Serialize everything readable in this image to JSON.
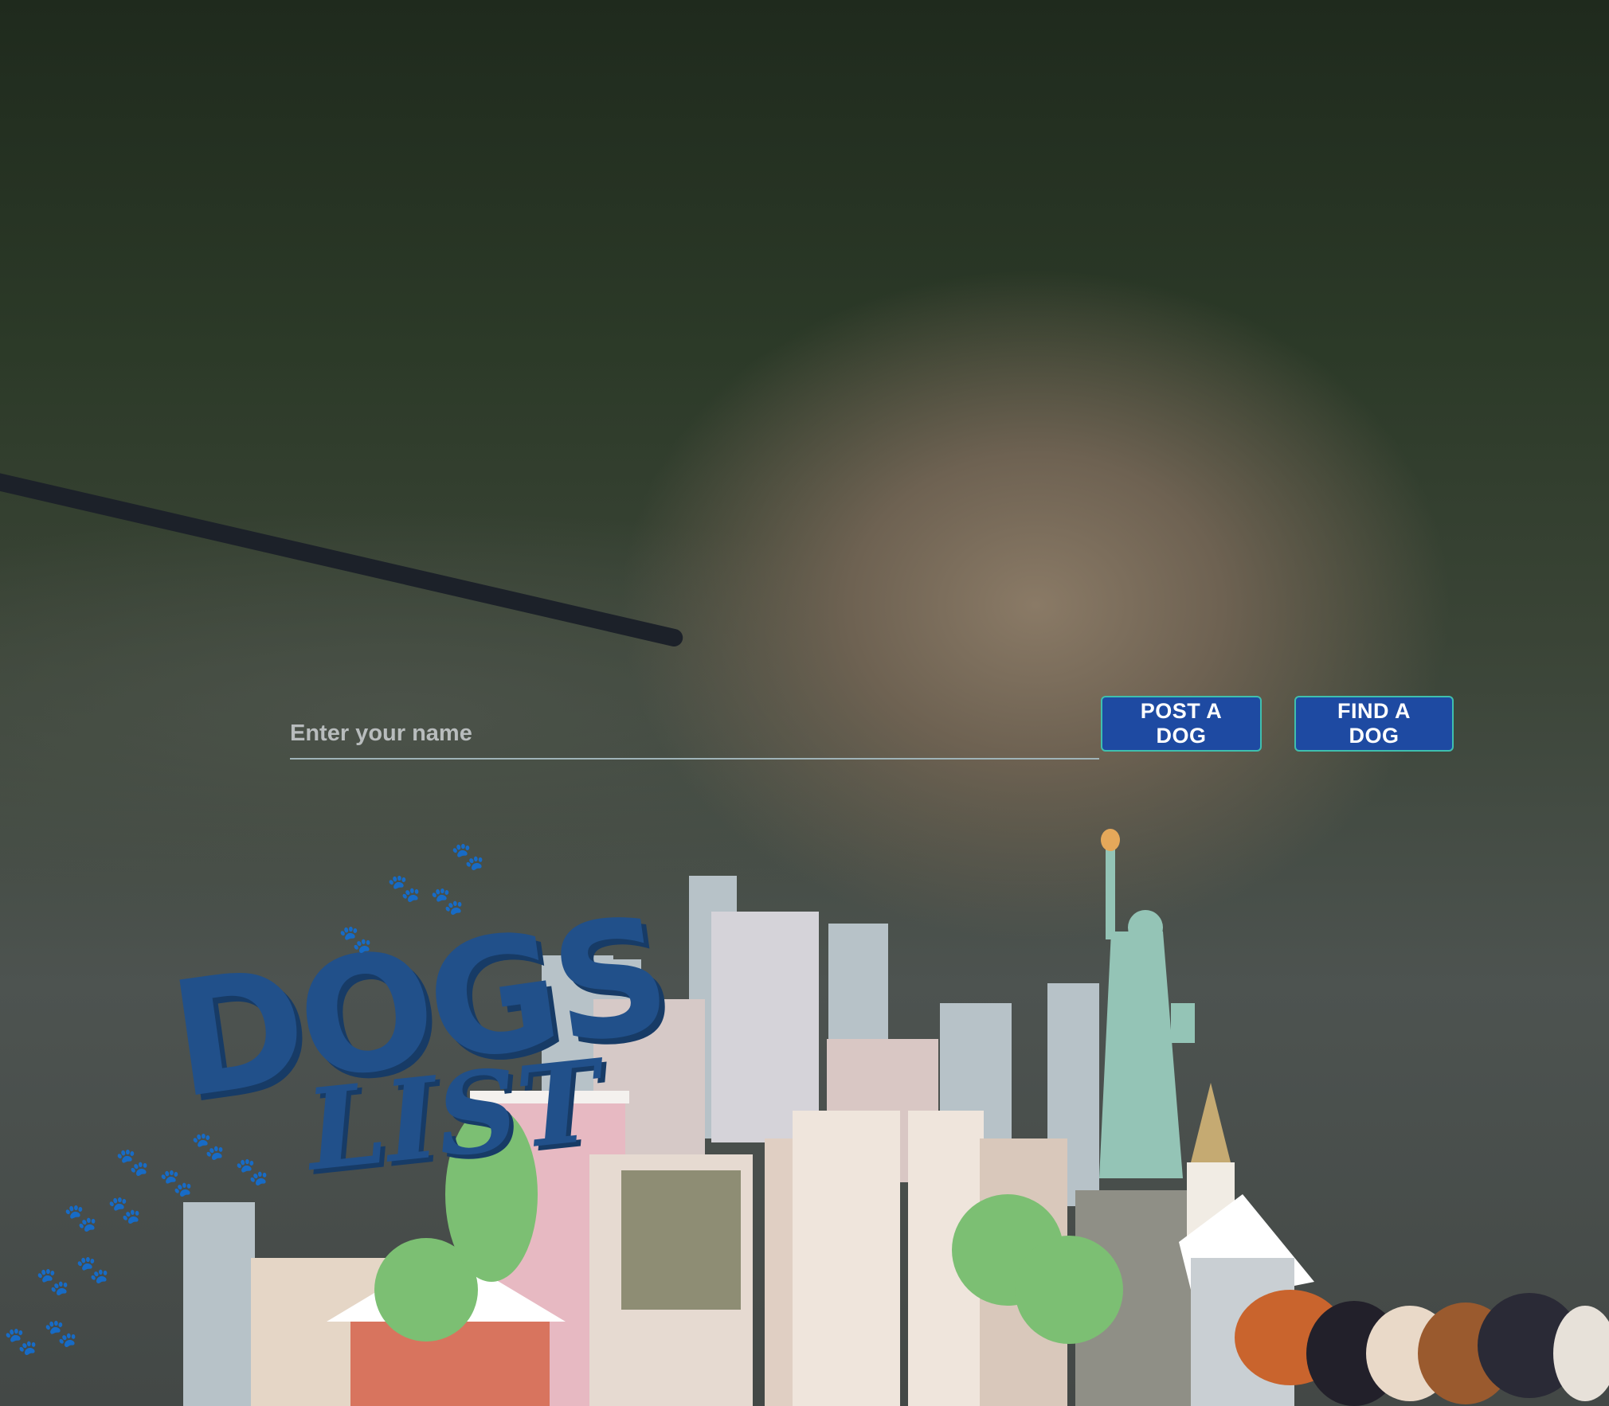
{
  "form": {
    "name_placeholder": "Enter your name",
    "post_button": "POST A DOG",
    "find_button": "FIND A DOG"
  },
  "logo": {
    "line1": "DOGS",
    "line2": "LIST"
  },
  "colors": {
    "button_bg": "#1e4aa2",
    "button_border": "#3fbfae",
    "logo_blue": "#21508a"
  }
}
